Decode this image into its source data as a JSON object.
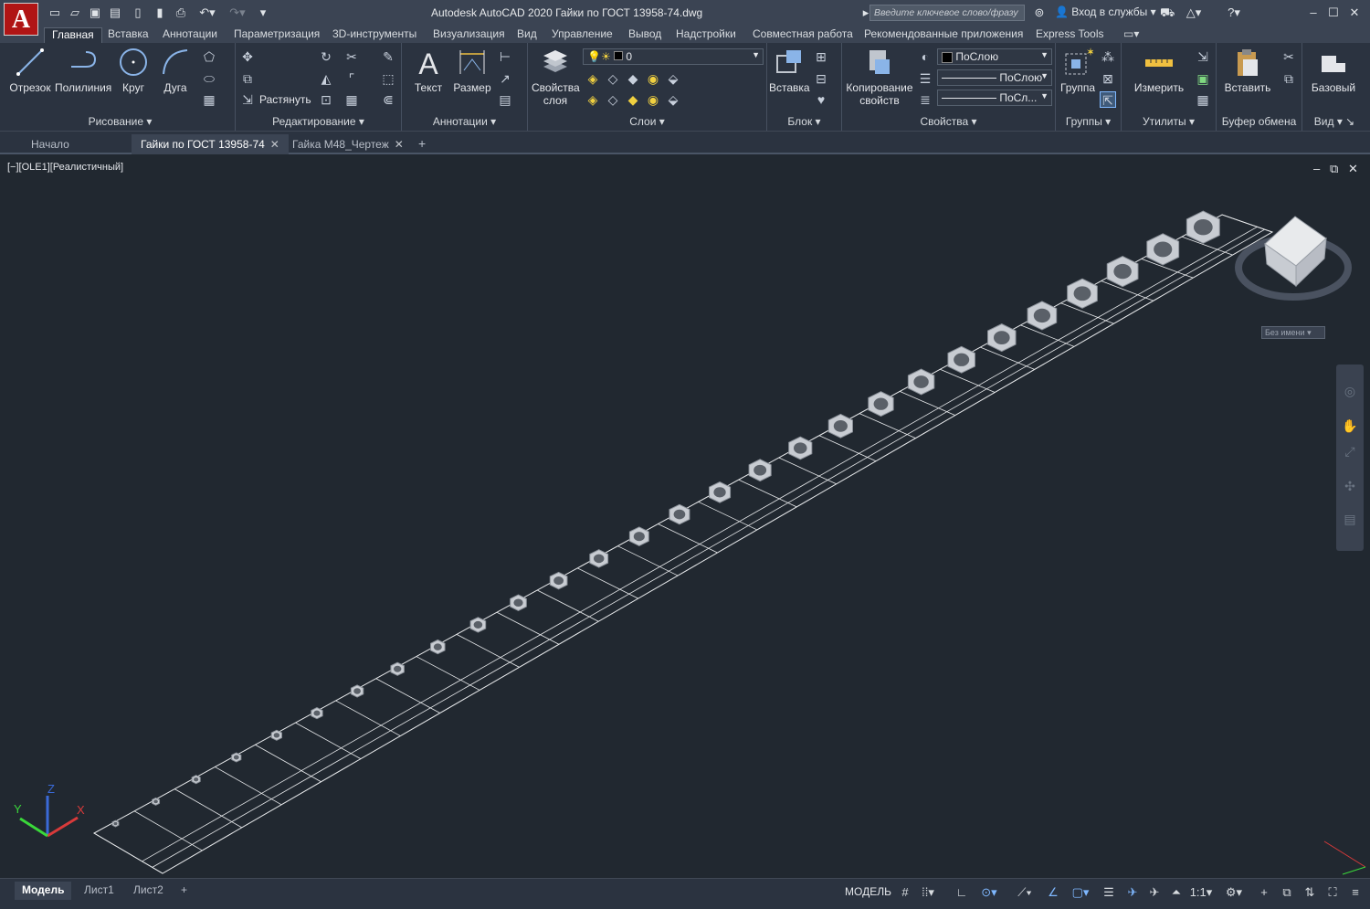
{
  "app": {
    "logo_letter": "A",
    "title": "Autodesk AutoCAD 2020    Гайки по ГОСТ 13958-74.dwg",
    "search_placeholder": "Введите ключевое слово/фразу",
    "sign_in": "Вход в службы"
  },
  "menu_tabs": [
    "Главная",
    "Вставка",
    "Аннотации",
    "Параметризация",
    "3D-инструменты",
    "Визуализация",
    "Вид",
    "Управление",
    "Вывод",
    "Надстройки",
    "Совместная работа",
    "Рекомендованные приложения",
    "Express Tools"
  ],
  "ribbon": {
    "draw": {
      "line": "Отрезок",
      "polyline": "Полилиния",
      "circle": "Круг",
      "arc": "Дуга",
      "title": "Рисование"
    },
    "modify": {
      "stretch": "Растянуть",
      "title": "Редактирование"
    },
    "annotate": {
      "text": "Текст",
      "dimension": "Размер",
      "title": "Аннотации"
    },
    "layers": {
      "props_1": "Свойства",
      "props_2": "слоя",
      "current_layer": "0",
      "title": "Слои"
    },
    "block": {
      "insert": "Вставка",
      "title": "Блок"
    },
    "properties": {
      "match_1": "Копирование",
      "match_2": "свойств",
      "color": "ПоСлою",
      "linetype": "ПоСлою",
      "lineweight": "ПоСл...",
      "title": "Свойства"
    },
    "groups": {
      "group": "Группа",
      "title": "Группы"
    },
    "utilities": {
      "measure": "Измерить",
      "title": "Утилиты"
    },
    "clipboard": {
      "paste": "Вставить",
      "title": "Буфер обмена"
    },
    "view": {
      "base": "Базовый",
      "title": "Вид"
    }
  },
  "doc_tabs": {
    "start": "Начало",
    "active": "Гайки по ГОСТ 13958-74",
    "other": "Гайка М48_Чертеж"
  },
  "viewport": {
    "label": "[−][OLE1][Реалистичный]",
    "viewcube_label": "Без имени",
    "axis_x": "X",
    "axis_y": "Y",
    "axis_z": "Z"
  },
  "layout_tabs": [
    "Модель",
    "Лист1",
    "Лист2"
  ],
  "status": {
    "model": "МОДЕЛЬ",
    "scale": "1:1"
  }
}
